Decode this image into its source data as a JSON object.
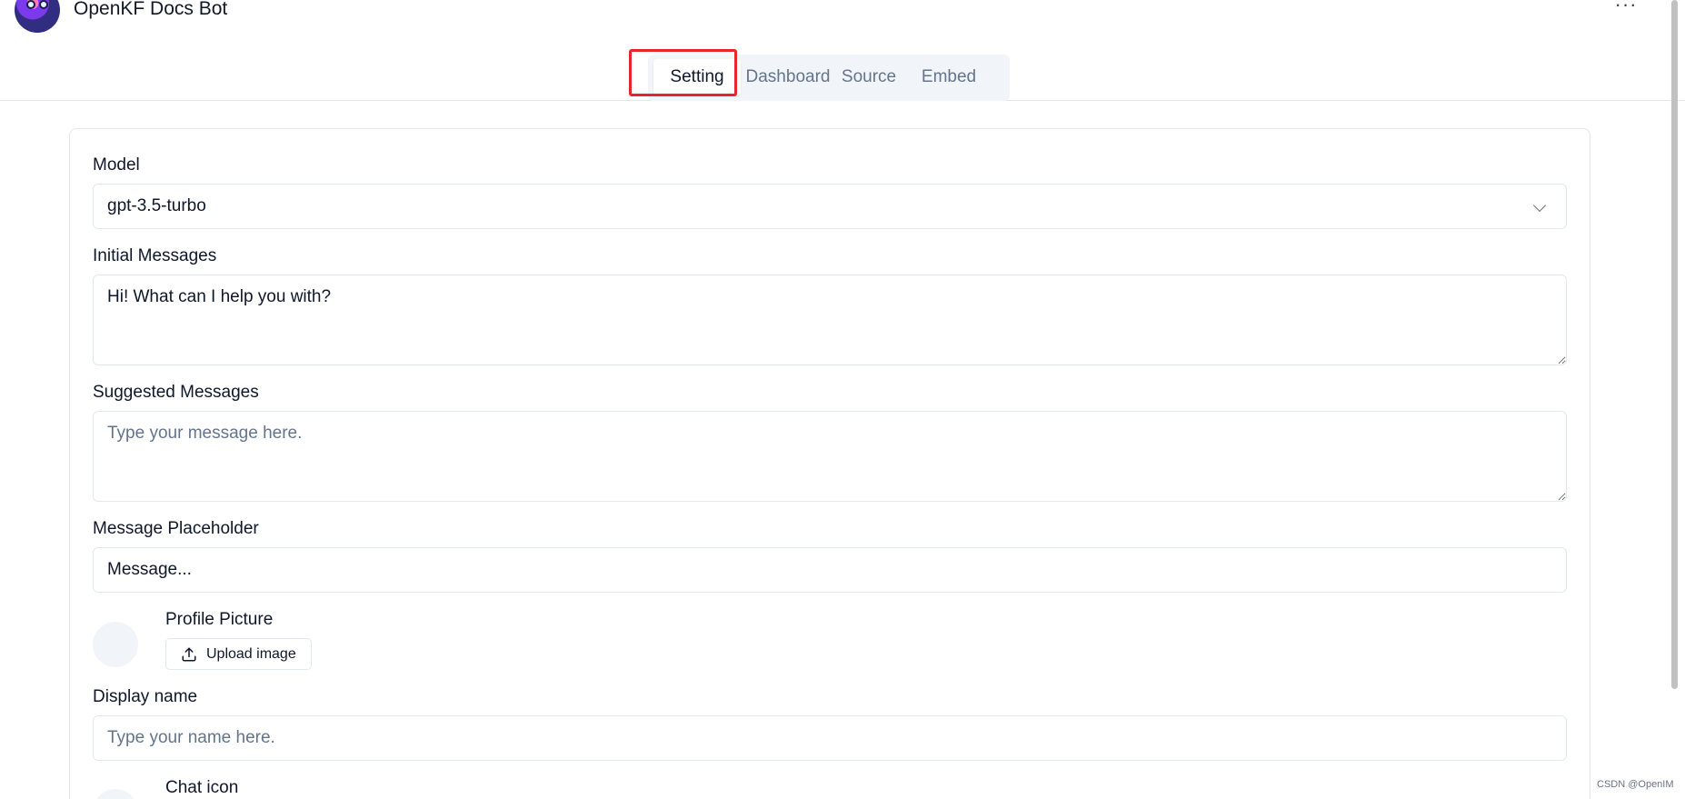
{
  "header": {
    "bot_name": "OpenKF Docs Bot",
    "more_icon": "ellipsis-icon",
    "more_text": "···"
  },
  "tabs": [
    {
      "label": "Setting",
      "active": true
    },
    {
      "label": "Dashboard",
      "active": false
    },
    {
      "label": "Source",
      "active": false
    },
    {
      "label": "Embed",
      "active": false
    }
  ],
  "form": {
    "model": {
      "label": "Model",
      "value": "gpt-3.5-turbo"
    },
    "initial_messages": {
      "label": "Initial Messages",
      "value": "Hi! What can I help you with?"
    },
    "suggested_messages": {
      "label": "Suggested Messages",
      "placeholder": "Type your message here."
    },
    "message_placeholder": {
      "label": "Message Placeholder",
      "value": "Message..."
    },
    "profile_picture": {
      "label": "Profile Picture",
      "upload_label": "Upload image"
    },
    "display_name": {
      "label": "Display name",
      "placeholder": "Type your name here."
    },
    "chat_icon": {
      "label": "Chat icon"
    }
  },
  "colors": {
    "accent_highlight": "#e5262c",
    "tab_bg": "#f1f5f9"
  },
  "watermark": "CSDN @OpenIM"
}
